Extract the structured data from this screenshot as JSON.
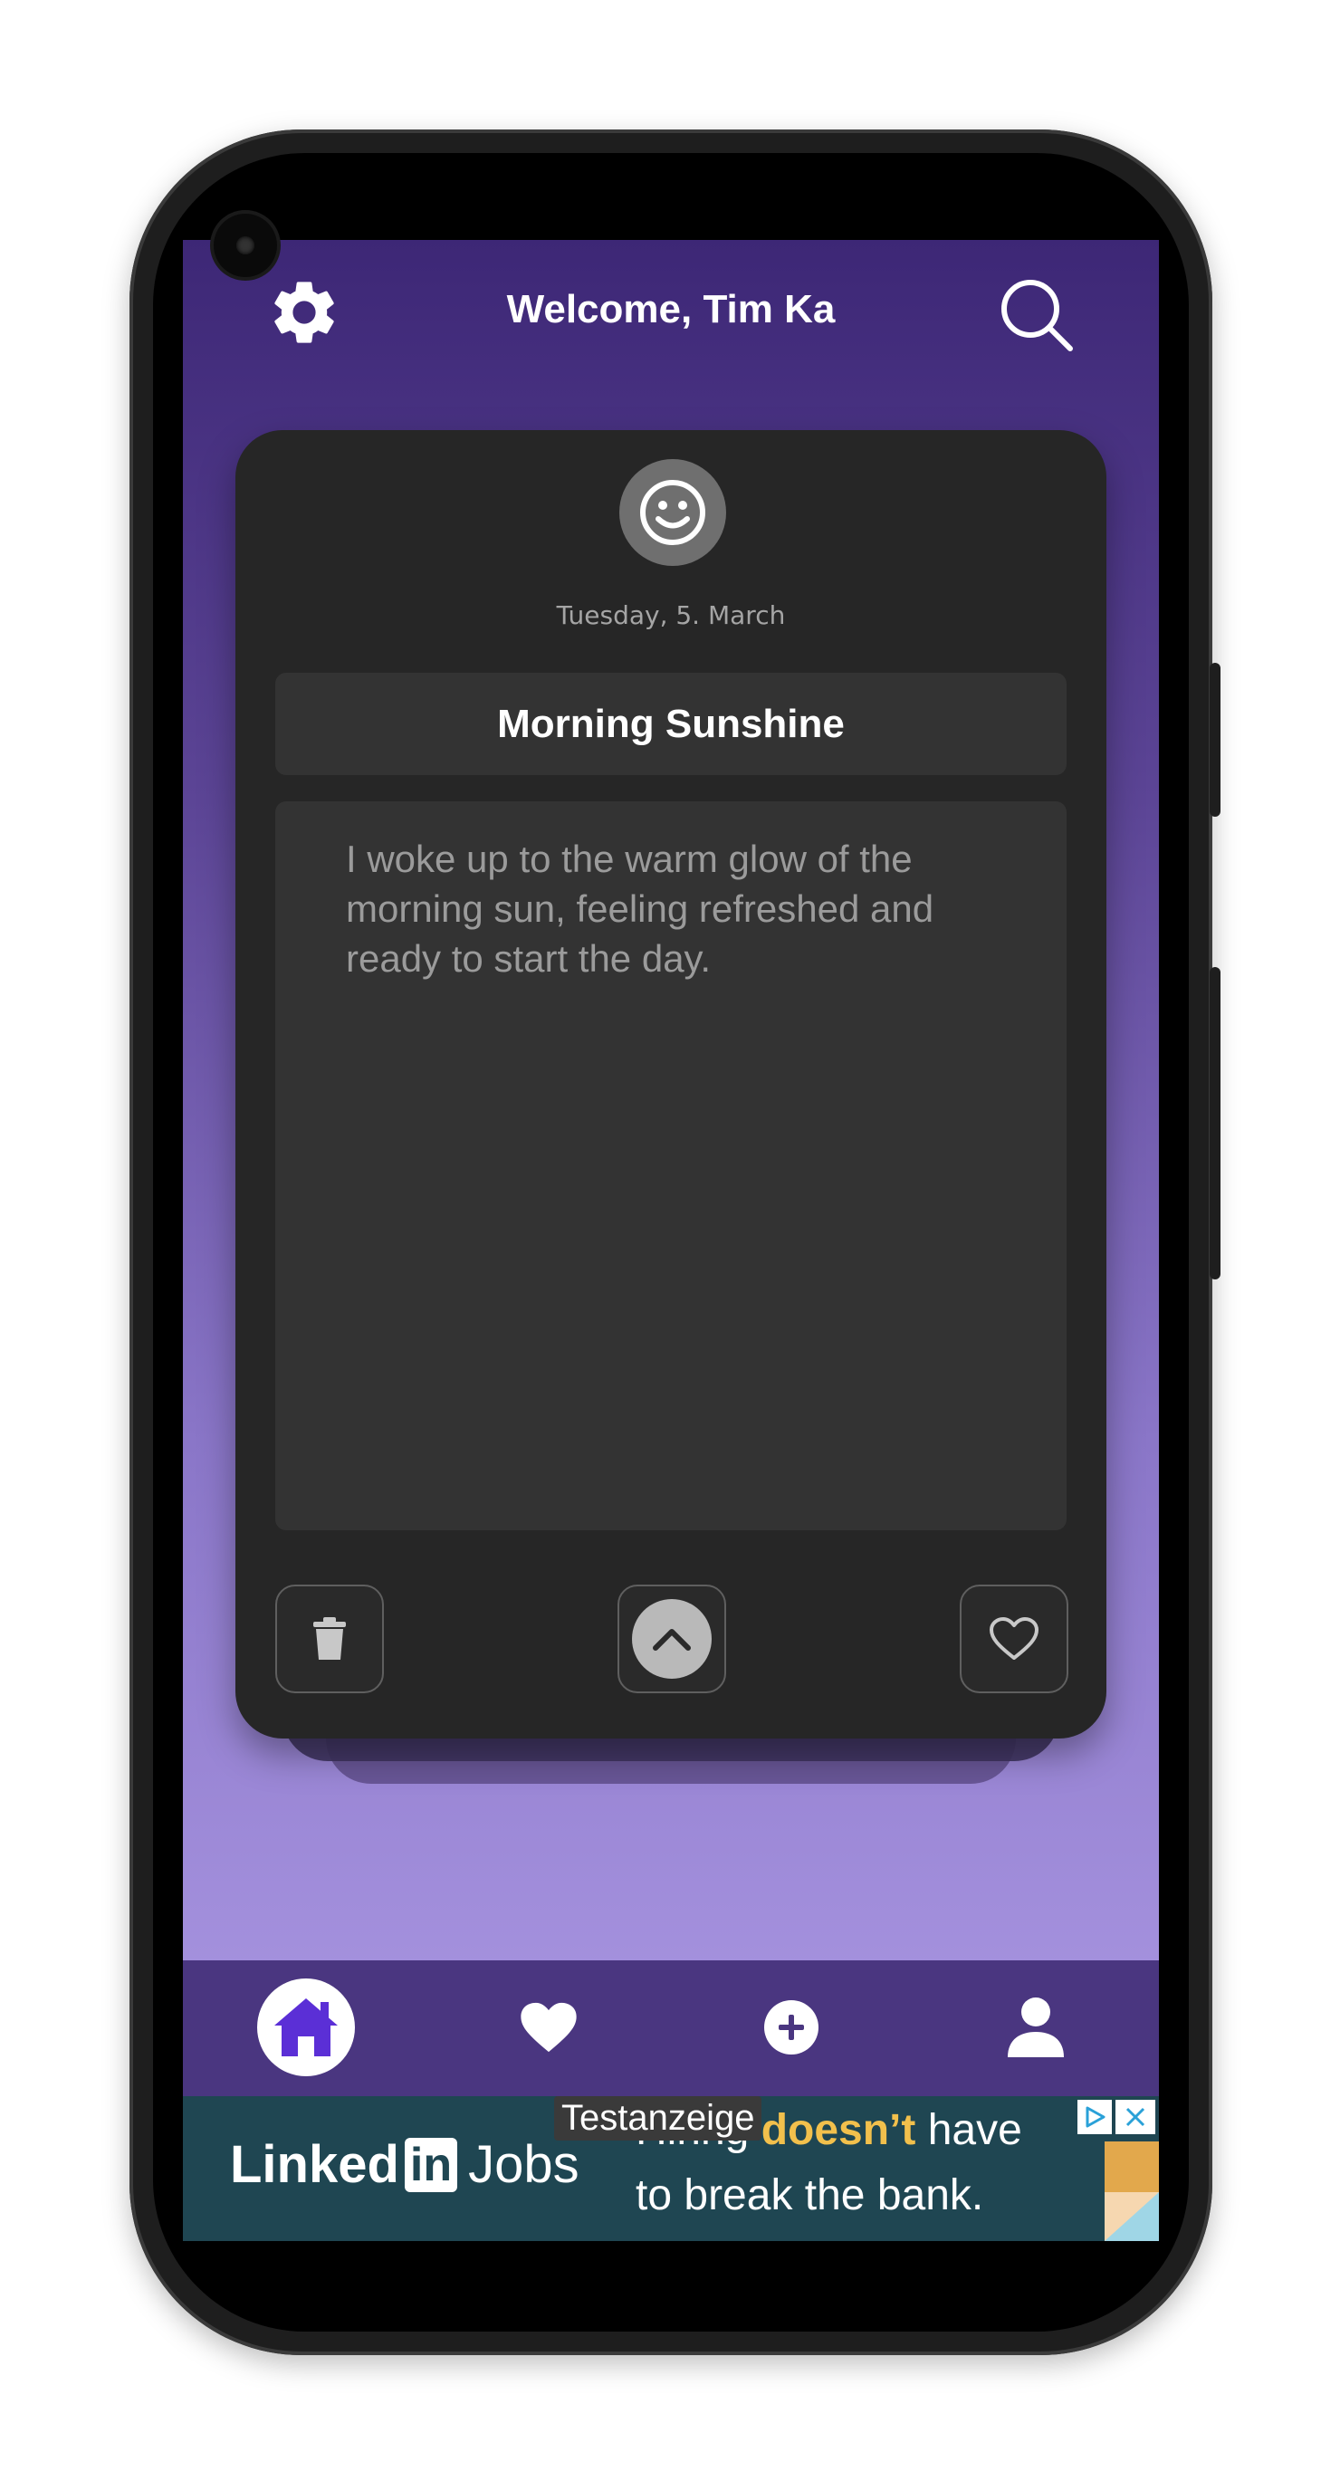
{
  "header": {
    "welcome_text": "Welcome, Tim Ka",
    "settings_icon": "gear-icon",
    "search_icon": "search-icon"
  },
  "entry": {
    "mood_icon": "smiley-face-icon",
    "date": "Tuesday, 5. March",
    "title": "Morning Sunshine",
    "body": "I woke up to the warm glow of the morning sun, feeling refreshed and ready to start the day.",
    "actions": {
      "delete_icon": "trash-icon",
      "expand_icon": "chevron-up-icon",
      "favorite_icon": "heart-outline-icon"
    }
  },
  "bottom_nav": {
    "items": [
      {
        "icon": "home-icon",
        "active": true
      },
      {
        "icon": "heart-icon",
        "active": false
      },
      {
        "icon": "plus-circle-icon",
        "active": false
      },
      {
        "icon": "profile-icon",
        "active": false
      }
    ]
  },
  "ad": {
    "label": "Testanzeige",
    "brand_a": "Linked",
    "brand_in": "in",
    "brand_b": "Jobs",
    "line1_prefix": "Hiring ",
    "line1_highlight": "doesn’t",
    "line1_suffix": " have",
    "line2": "to break the bank."
  },
  "colors": {
    "gradient_top": "#3d2776",
    "gradient_bottom": "#b19ee8",
    "card_bg": "#262626",
    "field_bg": "#333333",
    "nav_bg": "#4a3680",
    "accent": "#5b2fd6",
    "ad_bg": "#1f4652",
    "ad_highlight": "#f2c04c"
  }
}
